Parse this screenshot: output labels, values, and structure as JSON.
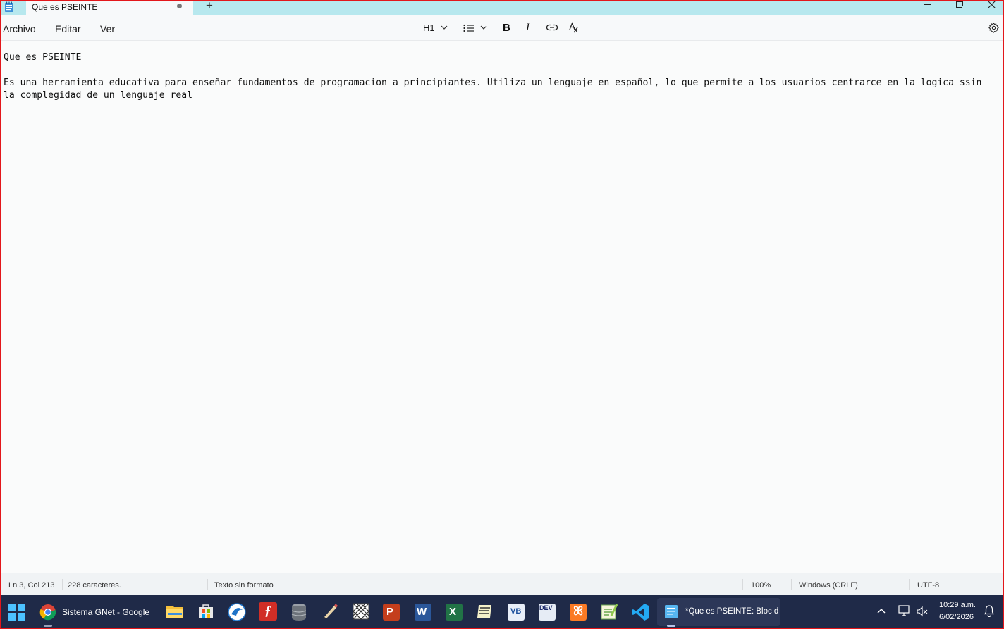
{
  "window": {
    "tab_title": "Que es PSEINTE",
    "new_tab": "+"
  },
  "menu": {
    "archivo": "Archivo",
    "editar": "Editar",
    "ver": "Ver"
  },
  "toolbar": {
    "heading": "H1",
    "list_icon": "list-icon",
    "bold_icon": "bold-icon",
    "italic_icon": "italic-icon",
    "link_icon": "link-icon",
    "clear_format_icon": "clear-formatting-icon",
    "settings_icon": "gear-icon"
  },
  "document": {
    "line1": "Que es PSEINTE",
    "line3a": "Es una herramienta educativa para enseñar fundamentos de programacion a principiantes. Utiliza un lenguaje en español, lo que permite a los usuarios centrarce en la logica ssin",
    "line3b": "la complegidad de un lenguaje real"
  },
  "status": {
    "position": "Ln 3, Col 213",
    "chars": "228 caracteres.",
    "format": "Texto sin formato",
    "zoom": "100%",
    "line_ending": "Windows (CRLF)",
    "encoding": "UTF-8"
  },
  "taskbar": {
    "chrome_label": "Sistema GNet - Google",
    "notepad_label": "*Que es PSEINTE: Bloc d",
    "time": "10:29 a.m.",
    "date": "6/02/2026",
    "icons": [
      "windows-start-icon",
      "chrome-icon",
      "file-explorer-icon",
      "microsoft-store-icon",
      "app-icon",
      "flash-icon",
      "database-icon",
      "pen-app-icon",
      "grid-app-icon",
      "powerpoint-icon",
      "word-icon",
      "excel-icon",
      "app-icon",
      "visual-basic-icon",
      "dev-cpp-icon",
      "xampp-icon",
      "notepad-plus-icon",
      "vscode-icon",
      "notepad-icon"
    ]
  },
  "colors": {
    "accent_titlebar": "#b7e8ee",
    "taskbar": "#1f2a48",
    "frame": "#e3171b"
  }
}
